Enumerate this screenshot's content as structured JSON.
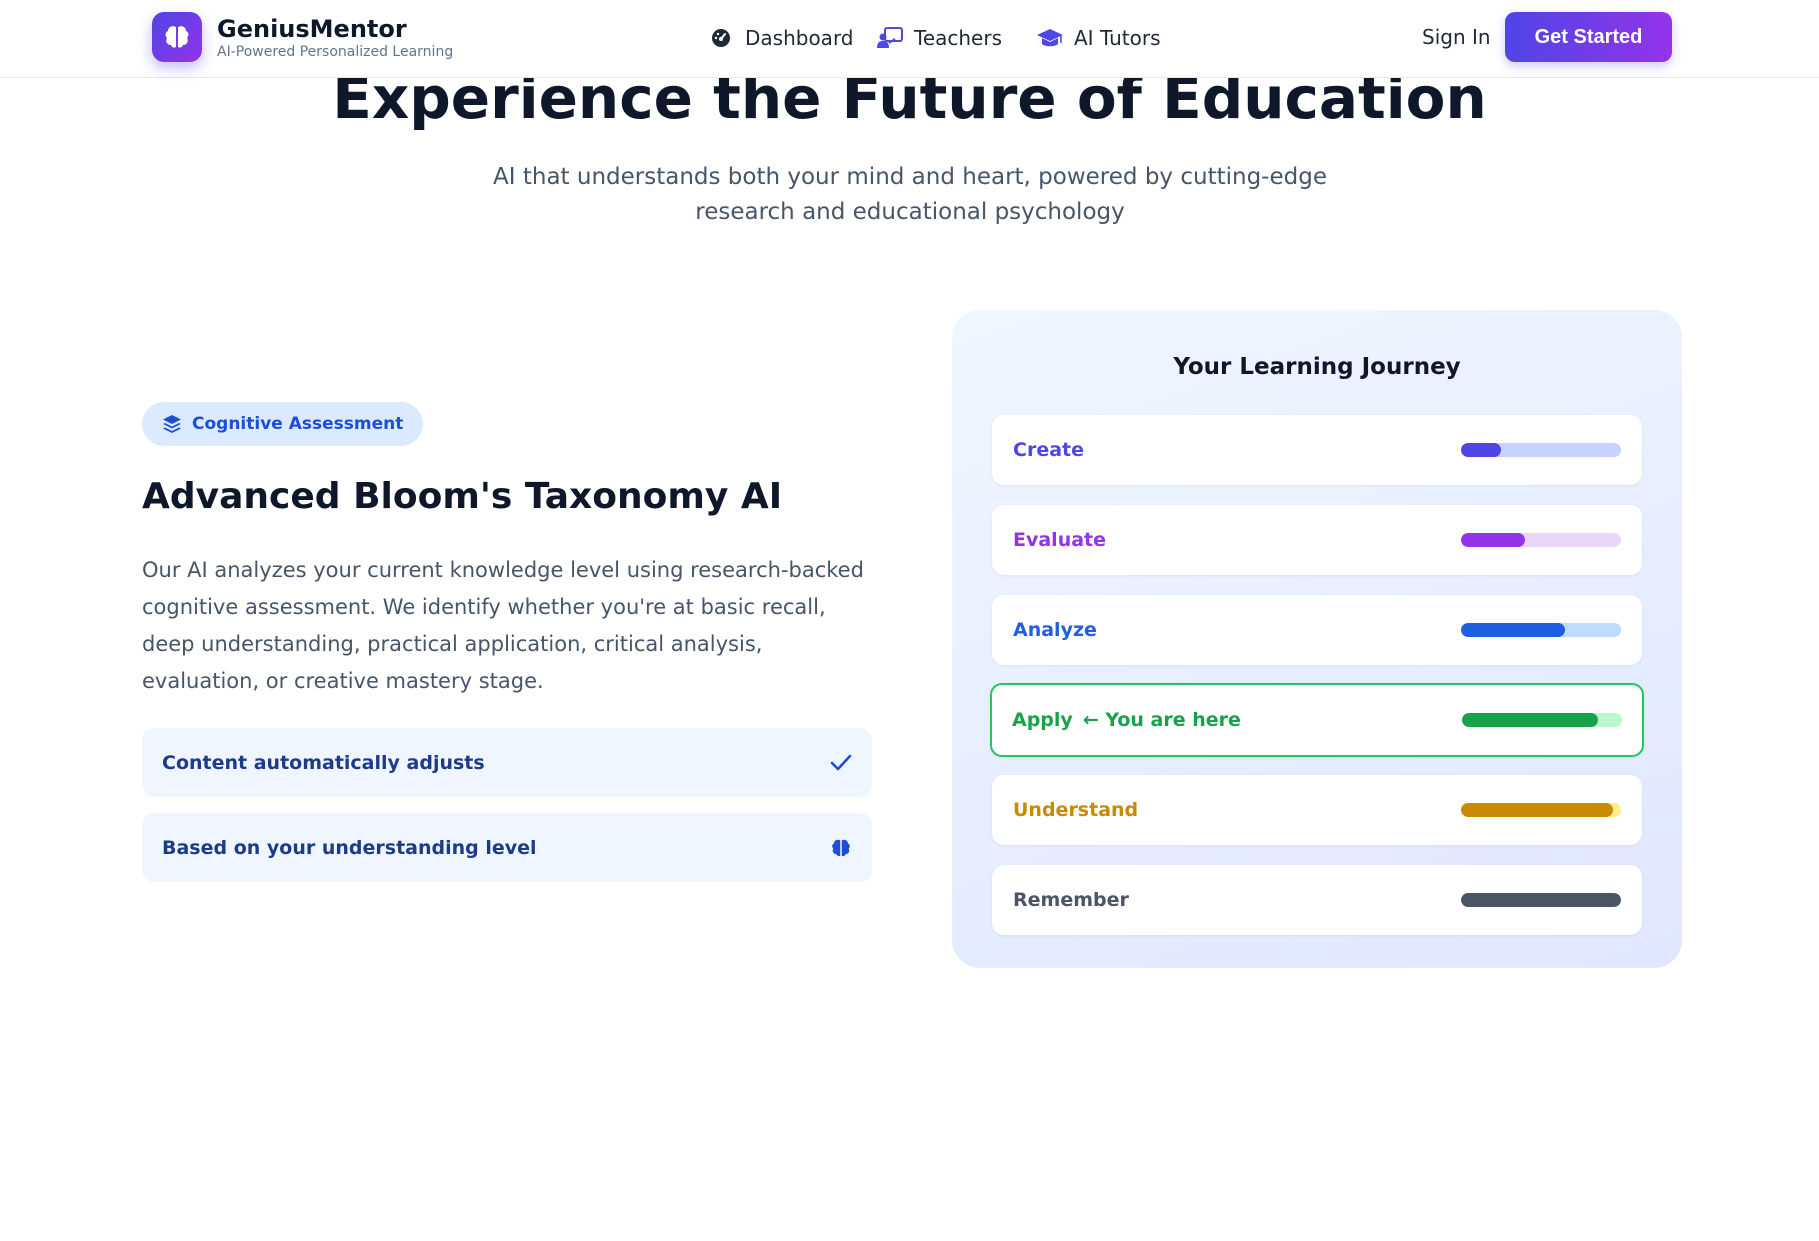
{
  "header": {
    "brand": "GeniusMentor",
    "tagline": "AI-Powered Personalized Learning",
    "logo_icon": "brain-icon",
    "nav": [
      {
        "label": "Dashboard",
        "icon": "gauge-icon"
      },
      {
        "label": "Teachers",
        "icon": "chalkboard-teacher-icon"
      },
      {
        "label": "AI Tutors",
        "icon": "graduation-cap-icon"
      }
    ],
    "sign_in": "Sign In",
    "cta": "Get Started"
  },
  "hero": {
    "title": "Experience the Future of Education",
    "subtitle": "AI that understands both your mind and heart, powered by cutting-edge research and educational psychology"
  },
  "feature": {
    "badge": {
      "label": "Cognitive Assessment",
      "icon": "layers-icon"
    },
    "title": "Advanced Bloom's Taxonomy AI",
    "description": "Our AI analyzes your current knowledge level using research-backed cognitive assessment. We identify whether you're at basic recall, deep understanding, practical application, critical analysis, evaluation, or creative mastery stage.",
    "points": [
      {
        "label": "Content automatically adjusts",
        "icon": "check-icon"
      },
      {
        "label": "Based on your understanding level",
        "icon": "brain-icon"
      }
    ]
  },
  "journey": {
    "title": "Your Learning Journey",
    "levels": [
      {
        "name": "Create",
        "note": "",
        "progress": 0.25,
        "color": "#4f46e5",
        "track": "#c7d2fe"
      },
      {
        "name": "Evaluate",
        "note": "",
        "progress": 0.4,
        "color": "#9333ea",
        "track": "#ead5fb"
      },
      {
        "name": "Analyze",
        "note": "",
        "progress": 0.65,
        "color": "#1d5fe0",
        "track": "#bfdbfe"
      },
      {
        "name": "Apply",
        "note": "← You are here",
        "progress": 0.85,
        "color": "#16a34a",
        "track": "#bbf7d0",
        "current": true
      },
      {
        "name": "Understand",
        "note": "",
        "progress": 0.95,
        "color": "#ca8a04",
        "track": "#fef08a"
      },
      {
        "name": "Remember",
        "note": "",
        "progress": 1.0,
        "color": "#4b5563",
        "track": "#e5e7eb"
      }
    ]
  }
}
